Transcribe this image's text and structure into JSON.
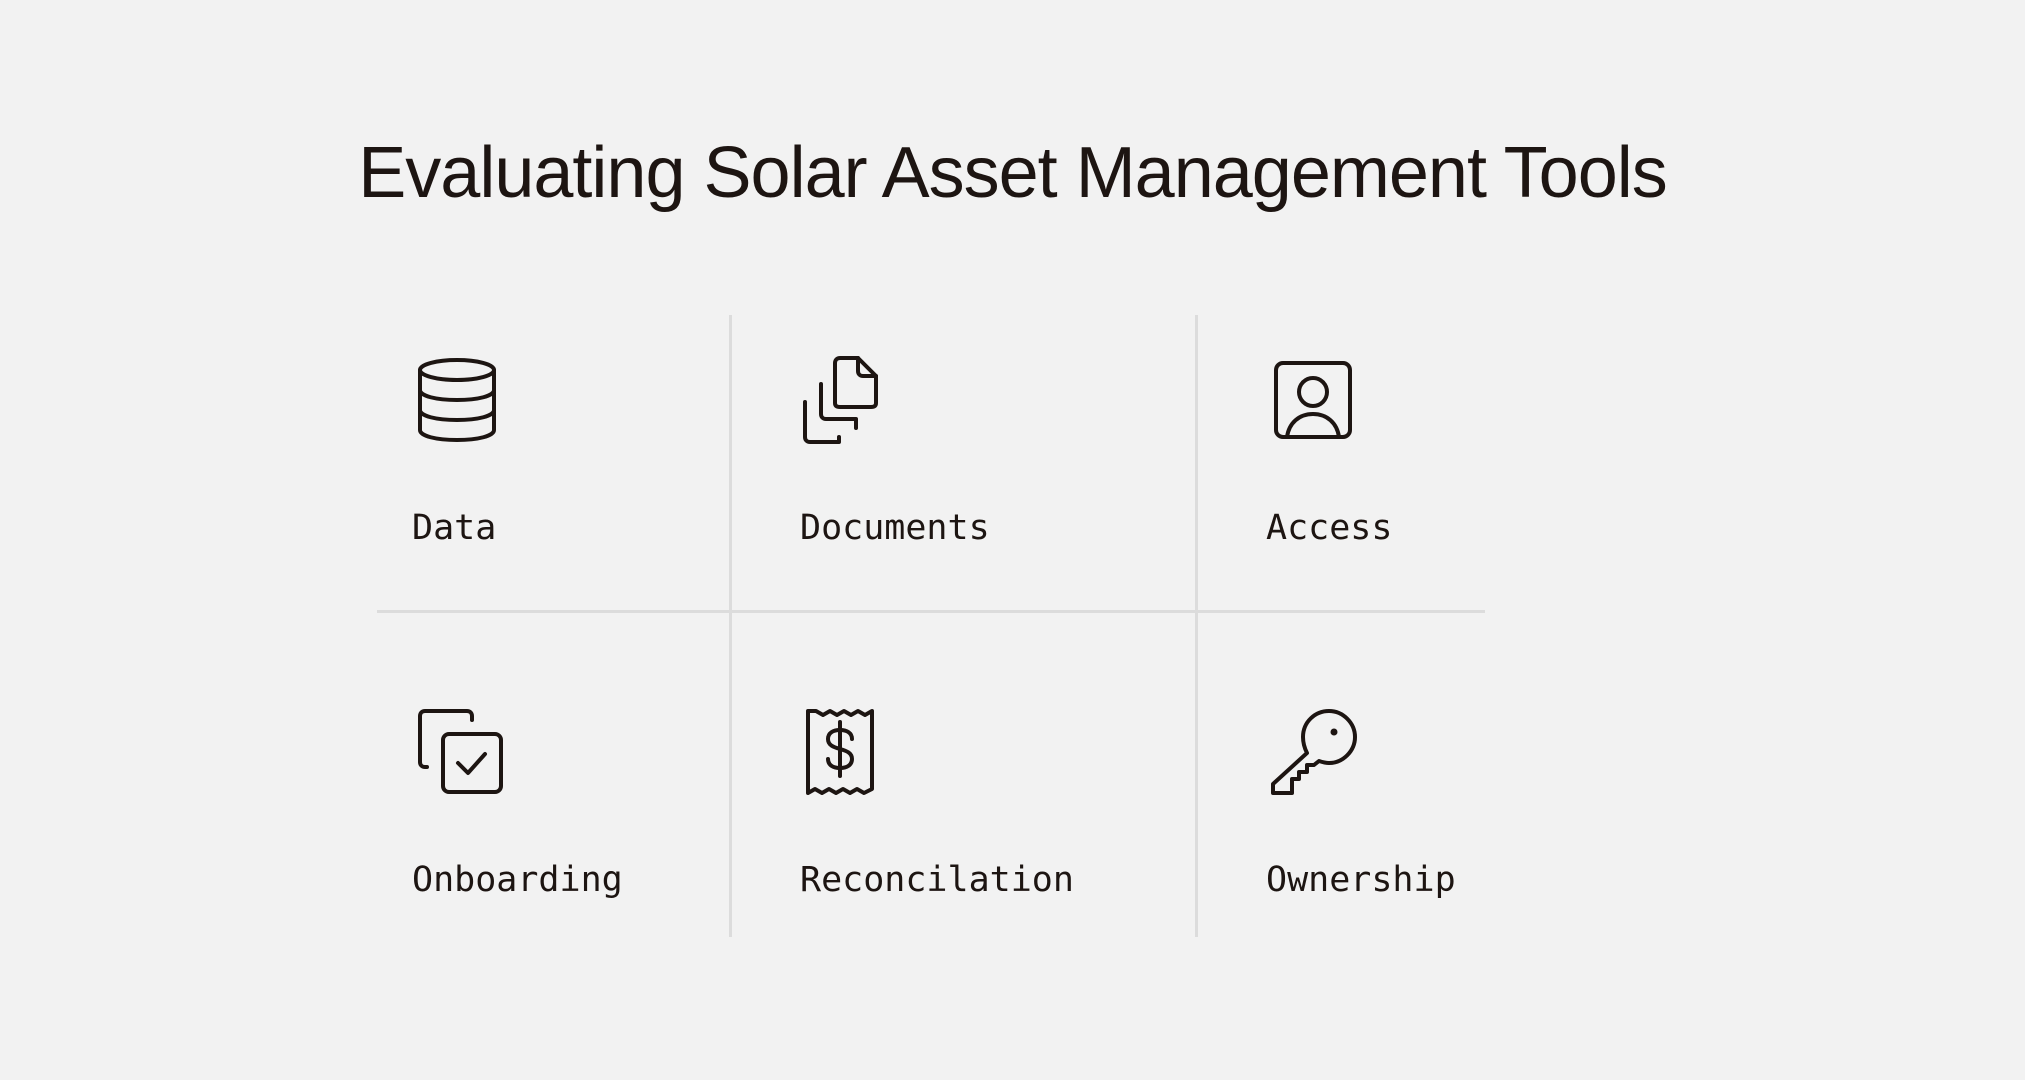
{
  "page": {
    "title": "Evaluating Solar Asset Management Tools"
  },
  "colors": {
    "background": "#f2f2f2",
    "text": "#1d1512",
    "divider": "#dcdcdc"
  },
  "cards": [
    {
      "label": "Data",
      "icon": "database-icon"
    },
    {
      "label": "Documents",
      "icon": "documents-icon"
    },
    {
      "label": "Access",
      "icon": "user-badge-icon"
    },
    {
      "label": "Onboarding",
      "icon": "checkbox-copy-icon"
    },
    {
      "label": "Reconcilation",
      "icon": "receipt-dollar-icon"
    },
    {
      "label": "Ownership",
      "icon": "key-icon"
    }
  ]
}
